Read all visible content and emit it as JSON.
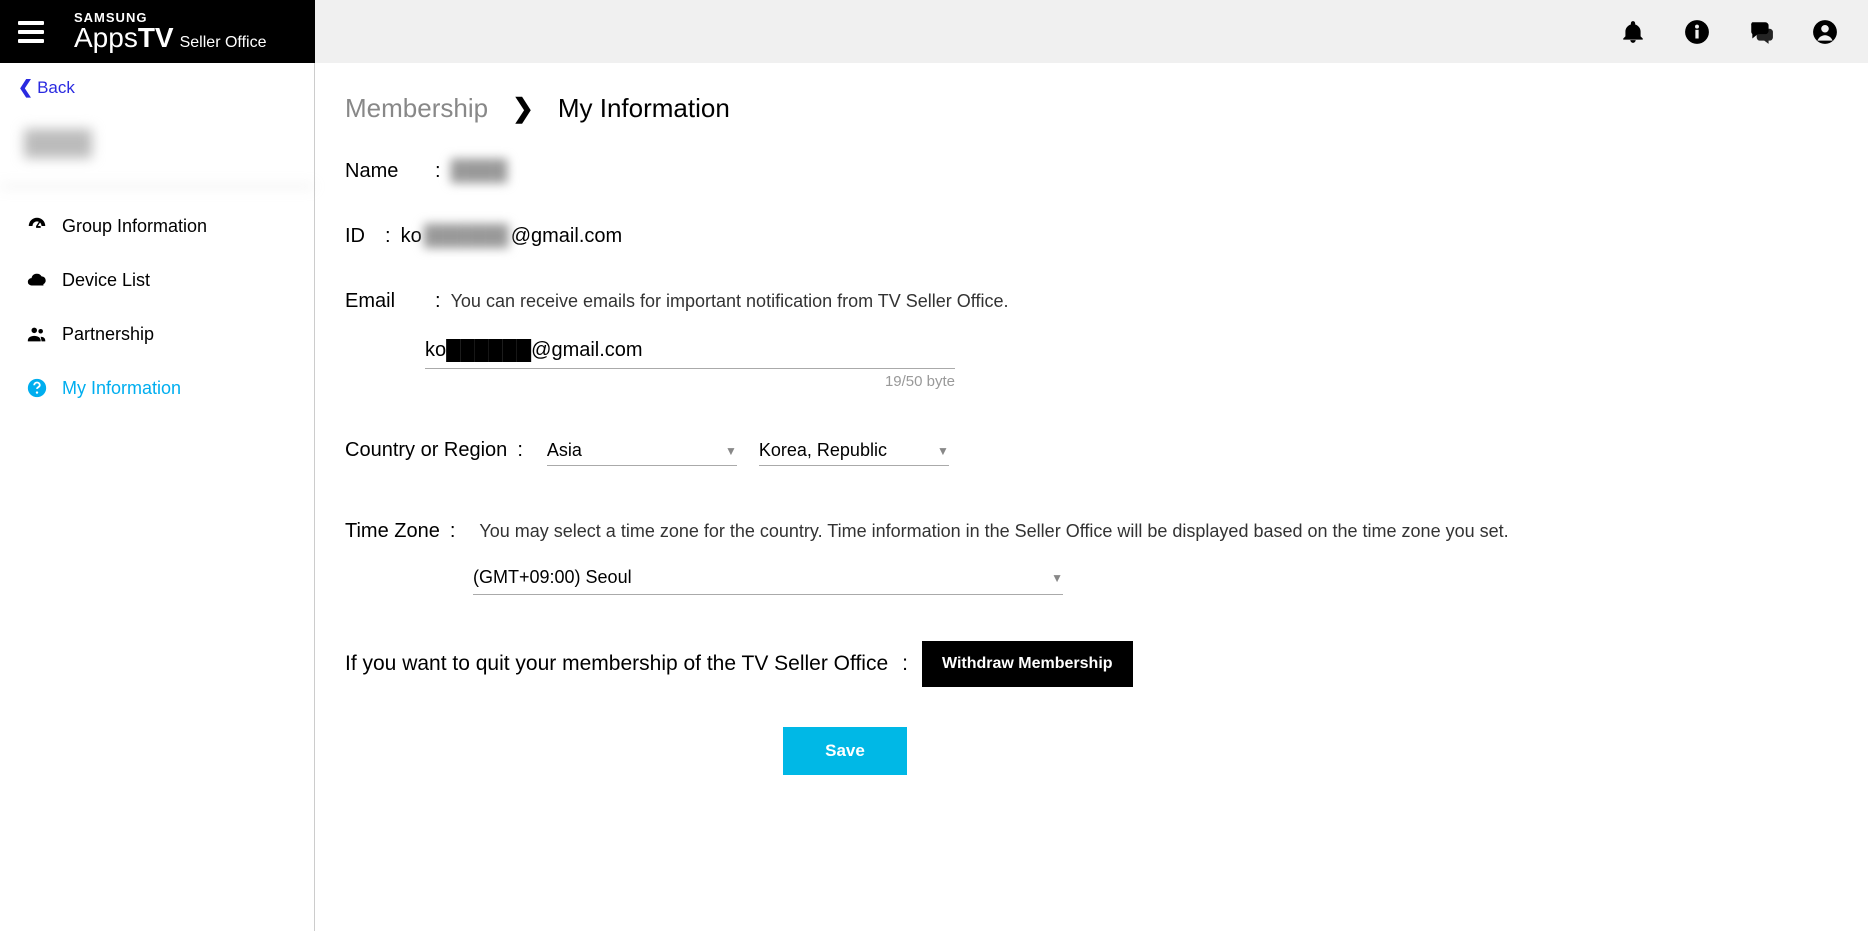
{
  "header": {
    "brand": "SAMSUNG",
    "logo_apps": "Apps",
    "logo_tv": "TV",
    "logo_seller": "Seller Office",
    "icons": {
      "bell": "bell-icon",
      "info": "info-icon",
      "chat": "chat-icon",
      "user": "user-icon"
    }
  },
  "sidebar": {
    "back_label": "Back",
    "profile_name": "████",
    "items": [
      {
        "label": "Group Information",
        "icon": "dashboard-icon"
      },
      {
        "label": "Device List",
        "icon": "cloud-icon"
      },
      {
        "label": "Partnership",
        "icon": "people-icon"
      },
      {
        "label": "My Information",
        "icon": "help-circle-icon"
      }
    ]
  },
  "breadcrumb": {
    "parent": "Membership",
    "current": "My Information"
  },
  "fields": {
    "name_label": "Name",
    "name_value": "████",
    "id_label": "ID",
    "id_prefix": "ko",
    "id_hidden": "██████",
    "id_suffix": "@gmail.com",
    "email_label": "Email",
    "email_desc": "You can receive emails for important notification from TV Seller Office.",
    "email_value": "ko██████@gmail.com",
    "email_bytes": "19/50 byte",
    "region_label": "Country or Region",
    "region_continent": "Asia",
    "region_country": "Korea, Republic",
    "tz_label": "Time Zone",
    "tz_desc": "You may select a time zone for the country. Time information in the Seller Office will be displayed based on the time zone you set.",
    "tz_value": "(GMT+09:00) Seoul",
    "withdraw_text": "If you want to quit your membership of the TV Seller Office",
    "withdraw_btn": "Withdraw Membership",
    "save_btn": "Save"
  }
}
